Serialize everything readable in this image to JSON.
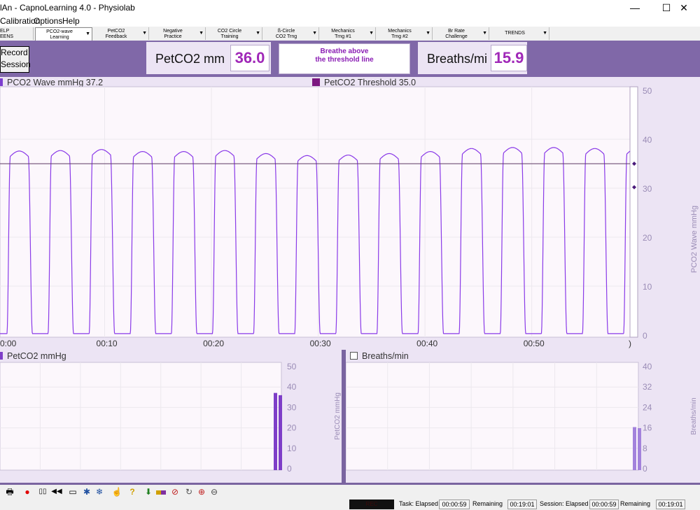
{
  "window": {
    "title": "lAn - CapnoLearning 4.0 - Physiolab",
    "minimize": "—",
    "maximize": "☐",
    "close": "✕"
  },
  "menu": [
    "Calibration",
    "Options",
    "Help"
  ],
  "tabs": [
    {
      "label": "ELP\nEENS"
    },
    {
      "label": "PCO2-wave\nLearning"
    },
    {
      "label": "PetCO2\nFeedback"
    },
    {
      "label": "Negative\nPractice"
    },
    {
      "label": "CO2 Circle\nTraining"
    },
    {
      "label": "ß-Circle\nCO2 Trng"
    },
    {
      "label": "Mechanics\nTrng #1"
    },
    {
      "label": "Mechanics\nTrng #2"
    },
    {
      "label": "Br Rate\nChallenge"
    },
    {
      "label": "TRENDS"
    }
  ],
  "header": {
    "record_button": "Record\nSession",
    "petco2_label": "PetCO2 mm",
    "petco2_value": "36.0",
    "message": "Breathe above\nthe threshold line",
    "breaths_label": "Breaths/mi",
    "breaths_value": "15.9"
  },
  "colors": {
    "header_bg": "#8068a8",
    "panel_bg": "#ece4f4",
    "plot_bg": "#fcf7fc",
    "wave": "#8a3ae8",
    "threshold": "#5c3a62",
    "value_text": "#a028b8",
    "bar_petco2": "#7e3ec8",
    "bar_breaths": "#a382dc"
  },
  "chart_data": [
    {
      "type": "line",
      "legend": [
        {
          "label": "PCO2 Wave mmHg 37.2",
          "color": "#7d3ecf"
        },
        {
          "label": "PetCO2 Threshold 35.0",
          "color": "#7c1880"
        }
      ],
      "ylabel": "PCO2 Wave mmHg",
      "ylim": [
        0,
        50
      ],
      "yticks": [
        "50",
        "40",
        "30",
        "20",
        "10",
        "0"
      ],
      "xlim": [
        0,
        59
      ],
      "xticks": [
        "0:00",
        "00:10",
        "00:20",
        "00:30",
        "00:40",
        "00:50",
        ")"
      ],
      "threshold": 35.0,
      "current_markers": [
        35.0,
        30.2
      ],
      "breath_period_s": 3.85,
      "peaks": [
        37.2,
        36.5,
        36.6,
        36.8,
        36.4,
        36.4,
        36.6,
        36.0,
        35.6,
        35.7,
        36.0,
        36.4,
        37.0,
        37.2,
        37.2,
        37.0
      ],
      "series": [
        {
          "name": "PCO2 Wave mmHg",
          "type": "line"
        },
        {
          "name": "PetCO2 Threshold",
          "type": "hline"
        }
      ]
    },
    {
      "type": "bar",
      "legend": "PetCO2 mmHg",
      "ylabel": "PetCO2 mmHg",
      "ylim": [
        0,
        50
      ],
      "yticks": [
        "50",
        "40",
        "30",
        "20",
        "10",
        "0"
      ],
      "values": [
        37.1,
        36.0
      ]
    },
    {
      "type": "bar",
      "legend": "Breaths/min",
      "ylabel": "Breaths/min",
      "ylim": [
        0,
        40
      ],
      "yticks": [
        "40",
        "32",
        "24",
        "16",
        "8",
        "0"
      ],
      "values": [
        16.3,
        15.9
      ]
    }
  ],
  "status": {
    "rec": "REC",
    "task_label": "Task: Elapsed",
    "task_elapsed": "00:00:59",
    "remaining_label": "Remaining",
    "task_remaining": "00:19:01",
    "session_label": "Session: Elapsed",
    "session_elapsed": "00:00:59",
    "remaining_label2": "Remaining",
    "session_remaining": "00:19:01"
  }
}
